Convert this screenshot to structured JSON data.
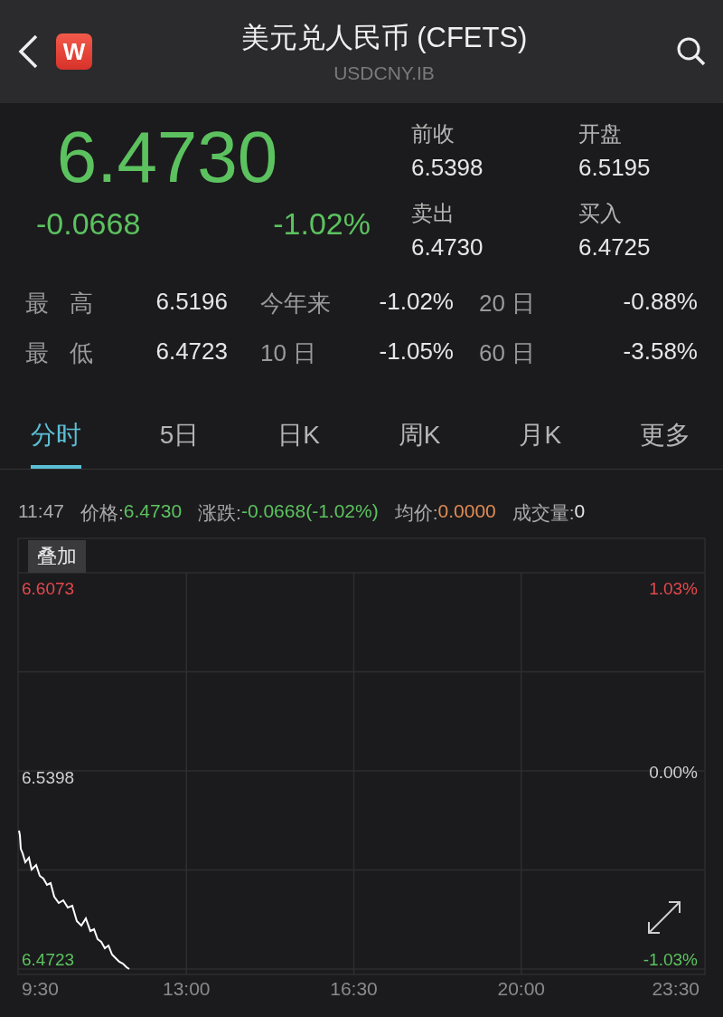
{
  "header": {
    "logo_text": "W",
    "title": "美元兑人民币 (CFETS)",
    "subtitle": "USDCNY.IB"
  },
  "quote": {
    "price": "6.4730",
    "change": "-0.0668",
    "change_pct": "-1.02%",
    "fields": [
      {
        "label": "前收",
        "value": "6.5398"
      },
      {
        "label": "开盘",
        "value": "6.5195"
      },
      {
        "label": "卖出",
        "value": "6.4730"
      },
      {
        "label": "买入",
        "value": "6.4725"
      }
    ]
  },
  "stats": [
    {
      "label": "最高",
      "value": "6.5196",
      "label2": "今年来",
      "value2": "-1.02%",
      "label3": "20 日",
      "value3": "-0.88%"
    },
    {
      "label": "最低",
      "value": "6.4723",
      "label2": "10 日",
      "value2": "-1.05%",
      "label3": "60 日",
      "value3": "-3.58%"
    }
  ],
  "tabs": [
    {
      "label": "分时",
      "selected": true
    },
    {
      "label": "5日",
      "selected": false
    },
    {
      "label": "日K",
      "selected": false
    },
    {
      "label": "周K",
      "selected": false
    },
    {
      "label": "月K",
      "selected": false
    },
    {
      "label": "更多",
      "selected": false
    }
  ],
  "info_bar": {
    "time": "11:47",
    "items": [
      {
        "label": "价格:",
        "value": "6.4730",
        "color": "#5cc25f"
      },
      {
        "label": "涨跌:",
        "value": "-0.0668(-1.02%)",
        "color": "#5cc25f"
      },
      {
        "label": "均价:",
        "value": "0.0000",
        "color": "#e08b55"
      },
      {
        "label": "成交量:",
        "value": "0",
        "color": "#e6e6e6"
      }
    ]
  },
  "chart": {
    "overlay_button": "叠加",
    "left_labels": [
      "6.6073",
      "6.5398",
      "6.4723"
    ],
    "right_labels": [
      "1.03%",
      "0.00%",
      "-1.03%"
    ],
    "x_labels": [
      "9:30",
      "13:00",
      "16:30",
      "20:00",
      "23:30"
    ]
  }
}
